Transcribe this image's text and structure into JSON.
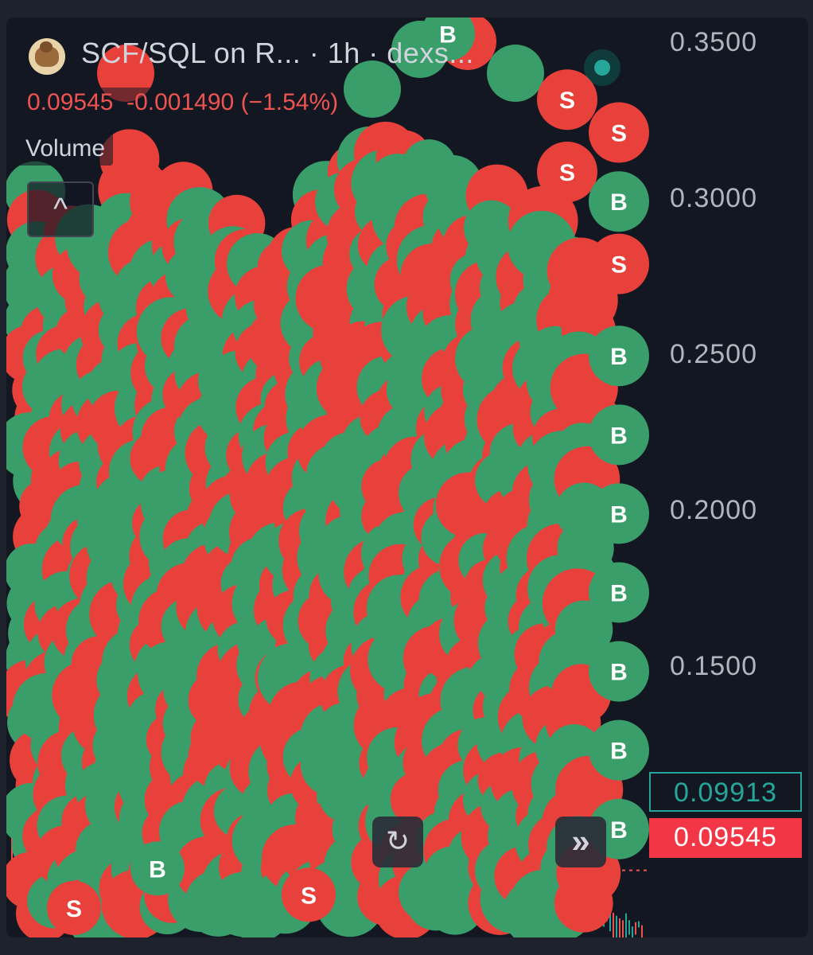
{
  "header": {
    "symbol_title": "SCF/SQL on R...  · 1h · dexs...",
    "ohlc_text": "0.09545  -0.001490 (−1.54%)",
    "volume_label": "Volume",
    "status_dot_color": "#26a69a",
    "logo_icon": "bull-logo-icon"
  },
  "controls": {
    "collapse_icon": "chevron-up-icon",
    "collapse_glyph": "^",
    "reset_icon": "refresh-icon",
    "reset_glyph": "↻",
    "scroll_to_realtime_icon": "double-chevron-right-icon",
    "scroll_to_realtime_glyph": "»"
  },
  "price_labels": {
    "high": "0.09913",
    "last": "0.09545"
  },
  "colors": {
    "up": "#26a69a",
    "down": "#ef5350",
    "buy_marker": "#3a9e6a",
    "sell_marker": "#e8413c",
    "background": "#131722"
  },
  "chart_data": {
    "type": "line",
    "title": "SCF/SQL on R...  · 1h · dexs...",
    "y_axis": {
      "ticks": [
        "0.3500",
        "0.3000",
        "0.2500",
        "0.2000",
        "0.1500"
      ],
      "ylim": [
        0.075,
        0.355
      ],
      "side": "right"
    },
    "last_price": 0.09545,
    "high_price": 0.09913,
    "change": -0.00149,
    "change_percent": -1.54,
    "trade_markers": {
      "buy_label": "B",
      "sell_label": "S",
      "right_column": [
        {
          "label": "S",
          "y": 0.33
        },
        {
          "label": "S",
          "y": 0.32
        },
        {
          "label": "S",
          "y": 0.308
        },
        {
          "label": "B",
          "y": 0.299
        },
        {
          "label": "S",
          "y": 0.28
        },
        {
          "label": "B",
          "y": 0.252
        },
        {
          "label": "B",
          "y": 0.228
        },
        {
          "label": "B",
          "y": 0.204
        },
        {
          "label": "B",
          "y": 0.18
        },
        {
          "label": "B",
          "y": 0.156
        },
        {
          "label": "B",
          "y": 0.132
        },
        {
          "label": "B",
          "y": 0.108
        }
      ],
      "scattered": [
        {
          "label": "B",
          "y": 0.35
        },
        {
          "label": "B",
          "y": 0.096
        },
        {
          "label": "S",
          "y": 0.088
        },
        {
          "label": "S",
          "y": 0.084
        }
      ]
    }
  }
}
